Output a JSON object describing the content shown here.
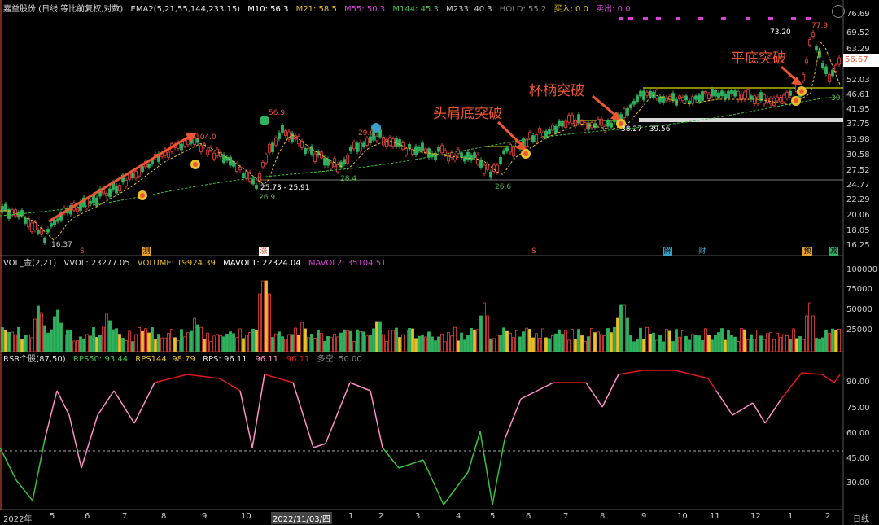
{
  "main_panel": {
    "title": "嘉益股份 (日线,等比前复权,对数)",
    "ema_label": "EMA2(5,21,55,144,233,15)",
    "ma": [
      {
        "label": "M10: 56.3",
        "color": "#ffffff"
      },
      {
        "label": "M21: 58.5",
        "color": "#e8c02a"
      },
      {
        "label": "M55: 50.3",
        "color": "#d642d6"
      },
      {
        "label": "M144: 45.3",
        "color": "#4dbf4d"
      },
      {
        "label": "M233: 40.3",
        "color": "#cccccc"
      },
      {
        "label": "HOLD: 55.2",
        "color": "#888888"
      },
      {
        "label": "买入: 0.0",
        "color": "#e8c02a"
      },
      {
        "label": "卖出: 0.0",
        "color": "#d642d6"
      }
    ],
    "y_ticks": [
      "76.69",
      "69.52",
      "63.29",
      "57.38",
      "52.03",
      "46.61",
      "41.95",
      "37.75",
      "33.98",
      "30.58",
      "27.52",
      "24.77",
      "22.29",
      "20.06",
      "18.05",
      "16.25"
    ],
    "current_price": "56.67",
    "price_labels": {
      "low": "16.37",
      "p1": "104.0",
      "p2": "56.9",
      "p3": "29.0",
      "range1": "25.73 - 25.91",
      "low2": "26.9",
      "low3": "28.4",
      "low4": "26.6",
      "range2": "38.27 - 39.56",
      "high1": "73.20",
      "high2": "77.9",
      "ma_end": "30."
    },
    "annotations": {
      "head_shoulder": "头肩底突破",
      "cup_handle": "杯柄突破",
      "flat_bottom": "平底突破"
    },
    "event_markers": [
      "S",
      "测",
      "涨",
      "S",
      "解",
      "财",
      "预",
      "减"
    ]
  },
  "vol_panel": {
    "title": "VOL_金(2,21)",
    "vvol": "VVOL: 23277.05",
    "volume": "VOLUME: 19924.39",
    "mavol1": "MAVOL1: 22324.04",
    "mavol2": "MAVOL2: 35104.51",
    "y_ticks": [
      "100000",
      "75000",
      "50000",
      "25000"
    ]
  },
  "rsr_panel": {
    "title": "RSR个股(87,50)",
    "rps50": "RPS50: 93.44",
    "rps144": "RPS144: 98.79",
    "rps": "RPS: 96.11",
    "v1": ": 96.11",
    "v2": ": 96.11",
    "duokong": "多空: 50.00",
    "y_ticks": [
      "90.00",
      "75.00",
      "60.00",
      "45.00",
      "30.00"
    ]
  },
  "x_axis": {
    "labels": [
      "2022年",
      "5",
      "6",
      "7",
      "8",
      "9",
      "10",
      "2022/11/03/四",
      "1",
      "2",
      "3",
      "4",
      "5",
      "6",
      "7",
      "8",
      "9",
      "10",
      "11",
      "12",
      "1",
      "2"
    ],
    "period": "日线"
  },
  "colors": {
    "up": "#e8413c",
    "down": "#2fb35f",
    "yellow": "#e8c02a",
    "purple": "#d642d6",
    "white": "#ffffff",
    "gray": "#888888",
    "red_line": "#e01818",
    "pink_line": "#ff8fc8",
    "green_line": "#3ac23a"
  }
}
